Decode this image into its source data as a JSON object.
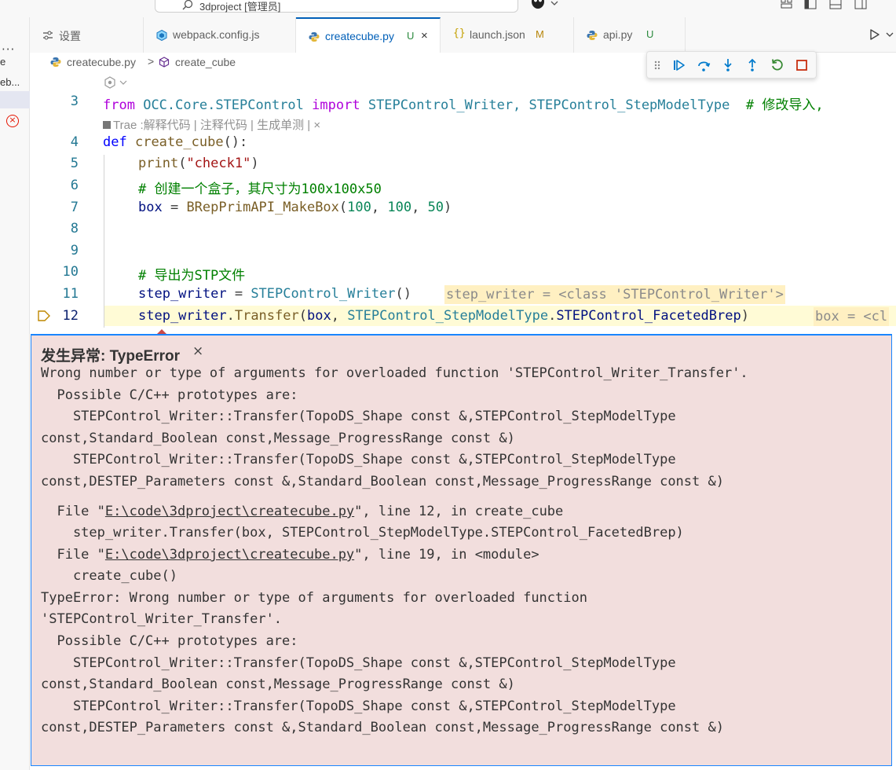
{
  "titlebar": {
    "search_text": "3dproject [管理员]"
  },
  "activity": {
    "more": "···",
    "item1": "e",
    "item2": "eb..."
  },
  "tabs": [
    {
      "label": "设置",
      "icon": "settings-icon"
    },
    {
      "label": "webpack.config.js",
      "icon": "config-file-icon"
    },
    {
      "label": "createcube.py",
      "status": "U",
      "icon": "python-file-icon",
      "close": "×"
    },
    {
      "label": "launch.json",
      "status": "M",
      "icon": "json-braces-icon"
    },
    {
      "label": "api.py",
      "status": "U",
      "icon": "python-file-icon"
    }
  ],
  "breadcrumb": {
    "file": "createcube.py",
    "separator": ">",
    "symbol": "create_cube"
  },
  "editor": {
    "hint_text": "Trae :解释代码 | 注释代码 | 生成单测 | ×",
    "line_numbers": [
      "3",
      "4",
      "5",
      "6",
      "7",
      "8",
      "9",
      "10",
      "11",
      "12"
    ],
    "line3": {
      "from": "from",
      "mod": "OCC.Core.STEPControl",
      "import": "import",
      "names": "STEPControl_Writer, STEPControl_StepModelType",
      "comment": "# 修改导入,"
    },
    "line4": {
      "def": "def",
      "name": "create_cube",
      "rest": "():"
    },
    "line5": {
      "fn": "print",
      "open": "(",
      "str": "\"check1\"",
      "close": ")"
    },
    "line6": {
      "comment": "# 创建一个盒子，其尺寸为100x100x50"
    },
    "line7": {
      "var": "box",
      "eq": " = ",
      "fn": "BRepPrimAPI_MakeBox",
      "open": "(",
      "a": "100",
      "c1": ", ",
      "b": "100",
      "c2": ", ",
      "c": "50",
      "close": ")"
    },
    "line10": {
      "comment": "# 导出为STP文件"
    },
    "line11": {
      "var": "step_writer",
      "eq": " = ",
      "cls": "STEPControl_Writer",
      "rest": "()",
      "inline": "step_writer = <class 'STEPControl_Writer'>"
    },
    "line12": {
      "var": "step_writer",
      "dot": ".",
      "fn": "Transfer",
      "open": "(",
      "arg1": "box",
      "c1": ", ",
      "cls": "STEPControl_StepModelType",
      "dot2": ".",
      "member": "STEPControl_FacetedBrep",
      "close": ")",
      "inline": "box = <cl"
    }
  },
  "exception": {
    "title": "发生异常: TypeError",
    "close": "×",
    "lines": [
      "Wrong number or type of arguments for overloaded function 'STEPControl_Writer_Transfer'.",
      "  Possible C/C++ prototypes are:",
      "    STEPControl_Writer::Transfer(TopoDS_Shape const &,STEPControl_StepModelType",
      "const,Standard_Boolean const,Message_ProgressRange const &)",
      "    STEPControl_Writer::Transfer(TopoDS_Shape const &,STEPControl_StepModelType",
      "const,DESTEP_Parameters const &,Standard_Boolean const,Message_ProgressRange const &)"
    ],
    "trace1": {
      "pre": "  File \"",
      "link": "E:\\code\\3dproject\\createcube.py",
      "post": "\", line 12, in create_cube"
    },
    "trace1_code": "    step_writer.Transfer(box, STEPControl_StepModelType.STEPControl_FacetedBrep)",
    "trace2": {
      "pre": "  File \"",
      "link": "E:\\code\\3dproject\\createcube.py",
      "post": "\", line 19, in <module>"
    },
    "trace2_code": "    create_cube()",
    "tail": [
      "TypeError: Wrong number or type of arguments for overloaded function",
      "'STEPControl_Writer_Transfer'.",
      "  Possible C/C++ prototypes are:",
      "    STEPControl_Writer::Transfer(TopoDS_Shape const &,STEPControl_StepModelType",
      "const,Standard_Boolean const,Message_ProgressRange const &)",
      "    STEPControl_Writer::Transfer(TopoDS_Shape const &,STEPControl_StepModelType",
      "const,DESTEP_Parameters const &,Standard_Boolean const,Message_ProgressRange const &)"
    ]
  },
  "colors": {
    "accent": "#005fb8",
    "exception_bg": "#f2dedd",
    "exception_border": "#1a85ff",
    "error": "#e51400",
    "current_line": "#fffbd6",
    "inline_value_bg": "#fff0c2"
  }
}
